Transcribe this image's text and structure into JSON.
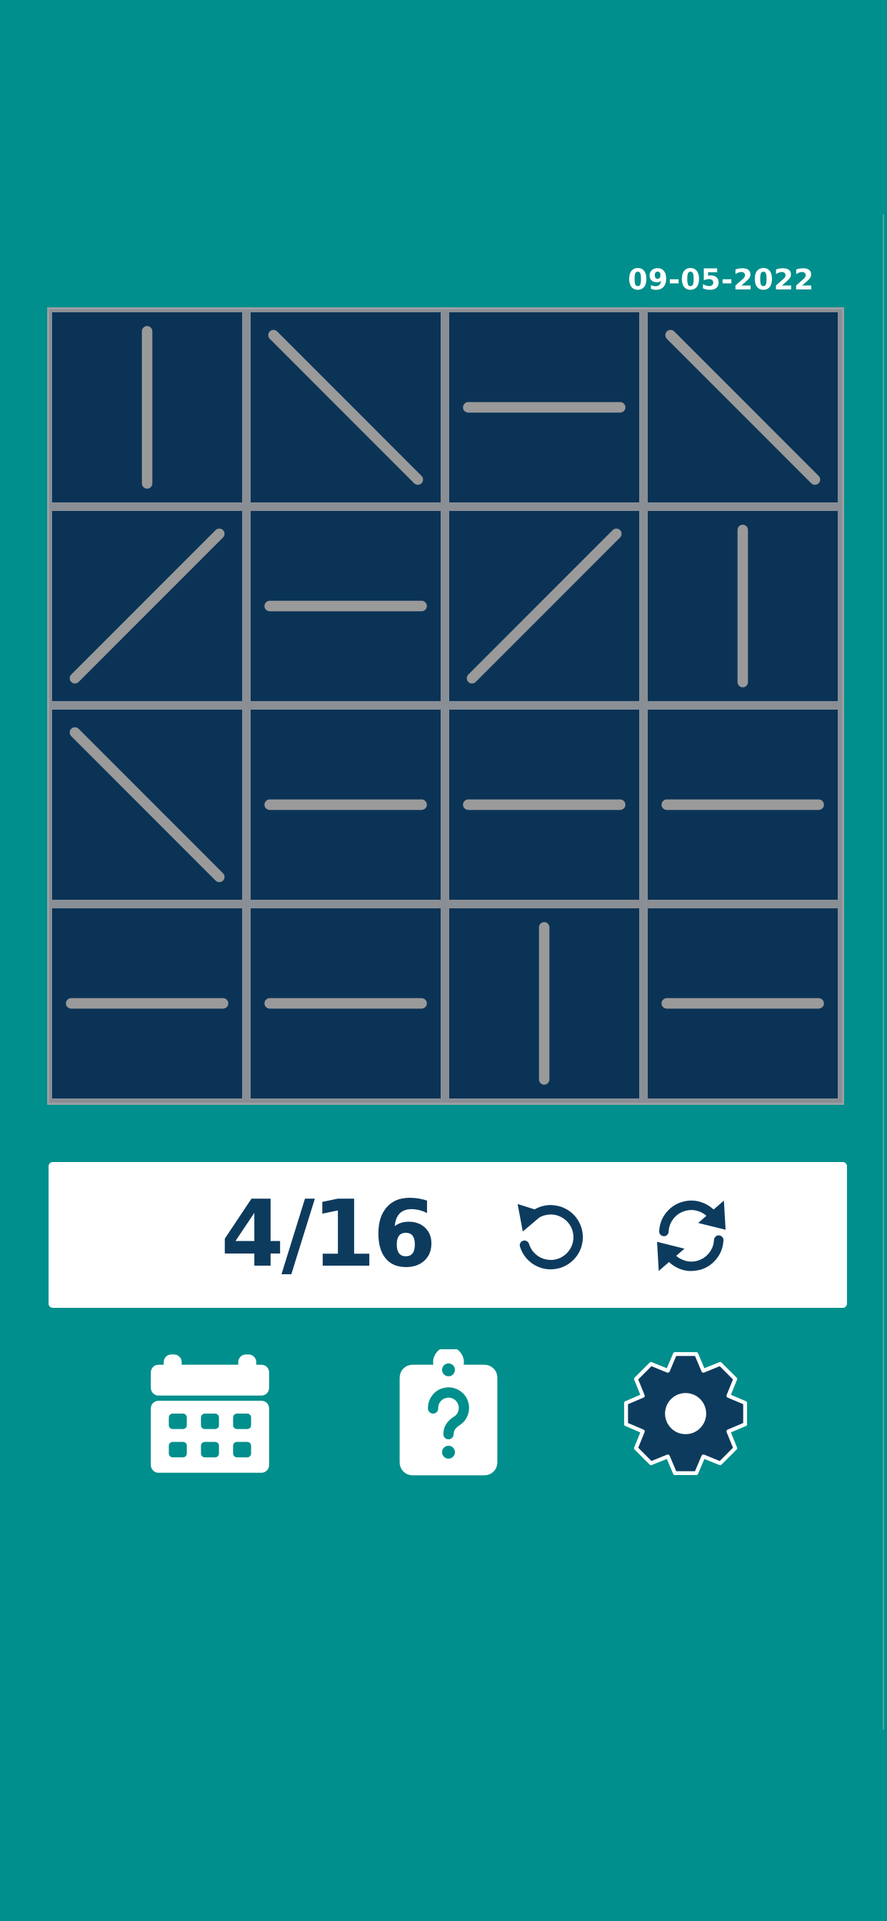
{
  "header": {
    "date": "09-05-2022"
  },
  "board": {
    "rows": 4,
    "cols": 4,
    "tiles": [
      [
        "vertical",
        "diag-down",
        "horizontal",
        "diag-down"
      ],
      [
        "diag-up",
        "horizontal",
        "diag-up",
        "vertical"
      ],
      [
        "diag-down",
        "horizontal",
        "horizontal",
        "horizontal"
      ],
      [
        "horizontal",
        "horizontal",
        "vertical",
        "horizontal"
      ]
    ]
  },
  "status": {
    "score": "4/16",
    "undo_icon": "undo-icon",
    "reset_icon": "refresh-icon"
  },
  "nav": {
    "calendar_icon": "calendar-icon",
    "help_icon": "clipboard-question-icon",
    "settings_icon": "gear-icon"
  },
  "colors": {
    "background": "#008f8c",
    "tile": "#0b3356",
    "line": "#9a9a9a",
    "accent_dark": "#0d3b5e",
    "white": "#ffffff"
  }
}
